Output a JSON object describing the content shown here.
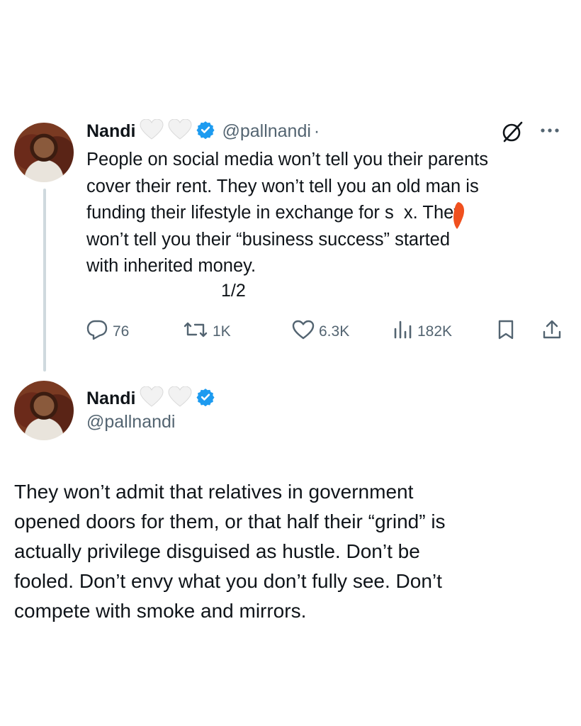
{
  "tweet1": {
    "author_name": "Nandi",
    "handle": "@pallnandi",
    "separator": "·",
    "text": "People on social media won’t tell you their parents\ncover their rent. They won’t tell you an old man is\nfunding their lifestyle in exchange for s  x. They\nwon’t tell you their “business success” started\nwith inherited money.",
    "part_counter": "1/2",
    "metrics": {
      "replies": "76",
      "reposts": "1K",
      "likes": "6.3K",
      "views": "182K"
    },
    "icons": [
      "chat-bubble-icon",
      "retweet-icon",
      "heart-outline-icon",
      "bar-chart-icon",
      "bookmark-icon",
      "share-icon",
      "grok-icon",
      "more-icon",
      "verified-badge-icon",
      "white-heart-icon"
    ]
  },
  "tweet2": {
    "author_name": "Nandi",
    "handle": "@pallnandi",
    "text": "They won’t admit that relatives in government\nopened doors for them, or that half their “grind” is\nactually privilege disguised as hustle. Don’t be\nfooled. Don’t envy what you don’t fully see. Don’t\ncompete with smoke and mirrors."
  },
  "colors": {
    "text": "#0f1419",
    "secondary": "#536471",
    "verified": "#1d9bf0",
    "thread_line": "#cfd9de",
    "censor_mark": "#f0501e"
  }
}
